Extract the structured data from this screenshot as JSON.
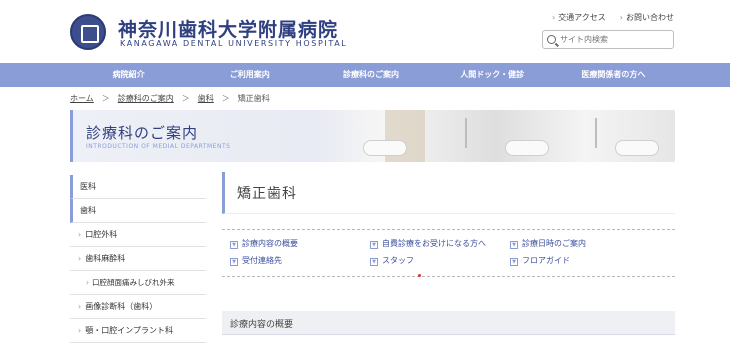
{
  "header": {
    "logo_jp": "神奈川歯科大学附属病院",
    "logo_en": "KANAGAWA DENTAL UNIVERSITY HOSPITAL",
    "links": [
      "交通アクセス",
      "お問い合わせ"
    ],
    "search_placeholder": "サイト内検索"
  },
  "nav": {
    "items": [
      "病院紹介",
      "ご利用案内",
      "診療科のご案内",
      "人間ドック・健診",
      "医療関係者の方へ"
    ]
  },
  "breadcrumb": {
    "home": "ホーム",
    "level1": "診療科のご案内",
    "level2": "歯科",
    "current": "矯正歯科",
    "sep": "＞"
  },
  "banner": {
    "title": "診療科のご案内",
    "subtitle": "INTRODUCTION OF MEDIAL DEPARTMENTS"
  },
  "sidebar": {
    "items": [
      {
        "label": "医科",
        "level": "top"
      },
      {
        "label": "歯科",
        "level": "top"
      },
      {
        "label": "口腔外科",
        "level": "sub"
      },
      {
        "label": "歯科麻酔科",
        "level": "sub"
      },
      {
        "label": "口腔顔面痛みしびれ外来",
        "level": "subsub"
      },
      {
        "label": "画像診断科（歯科）",
        "level": "sub"
      },
      {
        "label": "顎・口腔インプラント科",
        "level": "sub"
      }
    ]
  },
  "main": {
    "title": "矯正歯科",
    "anchors": [
      "診療内容の概要",
      "自費診療をお受けになる方へ",
      "診療日時のご案内",
      "受付連絡先",
      "スタッフ",
      "フロアガイド"
    ],
    "section_title": "診療内容の概要"
  },
  "colors": {
    "brand": "#2f3f80",
    "nav": "#8b9dd6",
    "link": "#3a4f9a"
  }
}
